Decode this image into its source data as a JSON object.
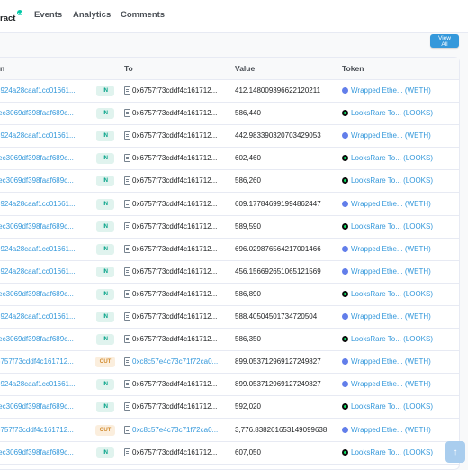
{
  "tabs": [
    {
      "label": "ract"
    },
    {
      "label": "Events"
    },
    {
      "label": "Analytics"
    },
    {
      "label": "Comments"
    }
  ],
  "toolbar": {
    "view_all_label": "View All"
  },
  "table": {
    "headers": {
      "from": "n",
      "to": "To",
      "value": "Value",
      "token": "Token"
    },
    "rows": [
      {
        "from": "5924a28caaf1cc01661...",
        "direction": "IN",
        "to": "0x6757f73cddf4c161712...",
        "to_is_link": false,
        "value": "412.148009396622120211",
        "token_icon": "weth",
        "token": "Wrapped Ethe... (WETH)"
      },
      {
        "from": "fec3069df398faaf689c...",
        "direction": "IN",
        "to": "0x6757f73cddf4c161712...",
        "to_is_link": false,
        "value": "586,440",
        "token_icon": "looks",
        "token": "LooksRare To... (LOOKS)"
      },
      {
        "from": "5924a28caaf1cc01661...",
        "direction": "IN",
        "to": "0x6757f73cddf4c161712...",
        "to_is_link": false,
        "value": "442.983390320703429053",
        "token_icon": "weth",
        "token": "Wrapped Ethe... (WETH)"
      },
      {
        "from": "fec3069df398faaf689c...",
        "direction": "IN",
        "to": "0x6757f73cddf4c161712...",
        "to_is_link": false,
        "value": "602,460",
        "token_icon": "looks",
        "token": "LooksRare To... (LOOKS)"
      },
      {
        "from": "fec3069df398faaf689c...",
        "direction": "IN",
        "to": "0x6757f73cddf4c161712...",
        "to_is_link": false,
        "value": "586,260",
        "token_icon": "looks",
        "token": "LooksRare To... (LOOKS)"
      },
      {
        "from": "5924a28caaf1cc01661...",
        "direction": "IN",
        "to": "0x6757f73cddf4c161712...",
        "to_is_link": false,
        "value": "609.177846991994862447",
        "token_icon": "weth",
        "token": "Wrapped Ethe... (WETH)"
      },
      {
        "from": "fec3069df398faaf689c...",
        "direction": "IN",
        "to": "0x6757f73cddf4c161712...",
        "to_is_link": false,
        "value": "589,590",
        "token_icon": "looks",
        "token": "LooksRare To... (LOOKS)"
      },
      {
        "from": "5924a28caaf1cc01661...",
        "direction": "IN",
        "to": "0x6757f73cddf4c161712...",
        "to_is_link": false,
        "value": "696.029876564217001466",
        "token_icon": "weth",
        "token": "Wrapped Ethe... (WETH)"
      },
      {
        "from": "5924a28caaf1cc01661...",
        "direction": "IN",
        "to": "0x6757f73cddf4c161712...",
        "to_is_link": false,
        "value": "456.156692651065121569",
        "token_icon": "weth",
        "token": "Wrapped Ethe... (WETH)"
      },
      {
        "from": "fec3069df398faaf689c...",
        "direction": "IN",
        "to": "0x6757f73cddf4c161712...",
        "to_is_link": false,
        "value": "586,890",
        "token_icon": "looks",
        "token": "LooksRare To... (LOOKS)"
      },
      {
        "from": "5924a28caaf1cc01661...",
        "direction": "IN",
        "to": "0x6757f73cddf4c161712...",
        "to_is_link": false,
        "value": "588.40504501734720504",
        "token_icon": "weth",
        "token": "Wrapped Ethe... (WETH)"
      },
      {
        "from": "fec3069df398faaf689c...",
        "direction": "IN",
        "to": "0x6757f73cddf4c161712...",
        "to_is_link": false,
        "value": "586,350",
        "token_icon": "looks",
        "token": "LooksRare To... (LOOKS)"
      },
      {
        "from": "6757f73cddf4c161712...",
        "direction": "OUT",
        "to": "0xc8c57e4c73c71f72ca0...",
        "to_is_link": true,
        "value": "899.053712969127249827",
        "token_icon": "weth",
        "token": "Wrapped Ethe... (WETH)"
      },
      {
        "from": "5924a28caaf1cc01661...",
        "direction": "IN",
        "to": "0x6757f73cddf4c161712...",
        "to_is_link": false,
        "value": "899.053712969127249827",
        "token_icon": "weth",
        "token": "Wrapped Ethe... (WETH)"
      },
      {
        "from": "fec3069df398faaf689c...",
        "direction": "IN",
        "to": "0x6757f73cddf4c161712...",
        "to_is_link": false,
        "value": "592,020",
        "token_icon": "looks",
        "token": "LooksRare To... (LOOKS)"
      },
      {
        "from": "6757f73cddf4c161712...",
        "direction": "OUT",
        "to": "0xc8c57e4c73c71f72ca0...",
        "to_is_link": true,
        "value": "3,776.838261653149099638",
        "token_icon": "weth",
        "token": "Wrapped Ethe... (WETH)"
      },
      {
        "from": "fec3069df398faaf689c...",
        "direction": "IN",
        "to": "0x6757f73cddf4c161712...",
        "to_is_link": false,
        "value": "607,050",
        "token_icon": "looks",
        "token": "LooksRare To... (LOOKS)"
      }
    ]
  },
  "scroll_top": {
    "icon": "arrow-up-icon",
    "glyph": "↑"
  },
  "colors": {
    "link": "#3498db",
    "in_badge": "#00a186",
    "out_badge": "#d18b2f",
    "accent": "#3498db"
  }
}
